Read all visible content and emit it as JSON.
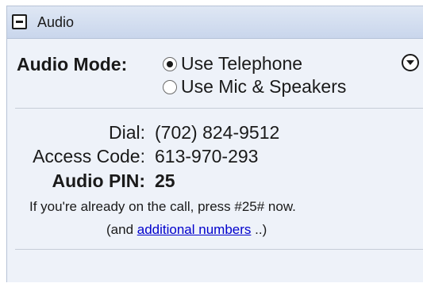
{
  "panel": {
    "title": "Audio",
    "collapse_icon": "minus-square-icon"
  },
  "audio_mode": {
    "label": "Audio Mode:",
    "options": [
      {
        "label": "Use Telephone",
        "selected": true
      },
      {
        "label": "Use Mic & Speakers",
        "selected": false
      }
    ],
    "menu_icon": "circle-chevron-down-icon"
  },
  "dial_info": {
    "dial_label": "Dial:",
    "dial_value": "(702) 824-9512",
    "access_label": "Access Code:",
    "access_value": "613-970-293",
    "pin_label": "Audio PIN:",
    "pin_value": "25"
  },
  "note": {
    "line1": "If you're already on the call, press #25# now.",
    "line2_prefix": "(and ",
    "line2_link": "additional numbers",
    "line2_suffix": " ..)"
  }
}
